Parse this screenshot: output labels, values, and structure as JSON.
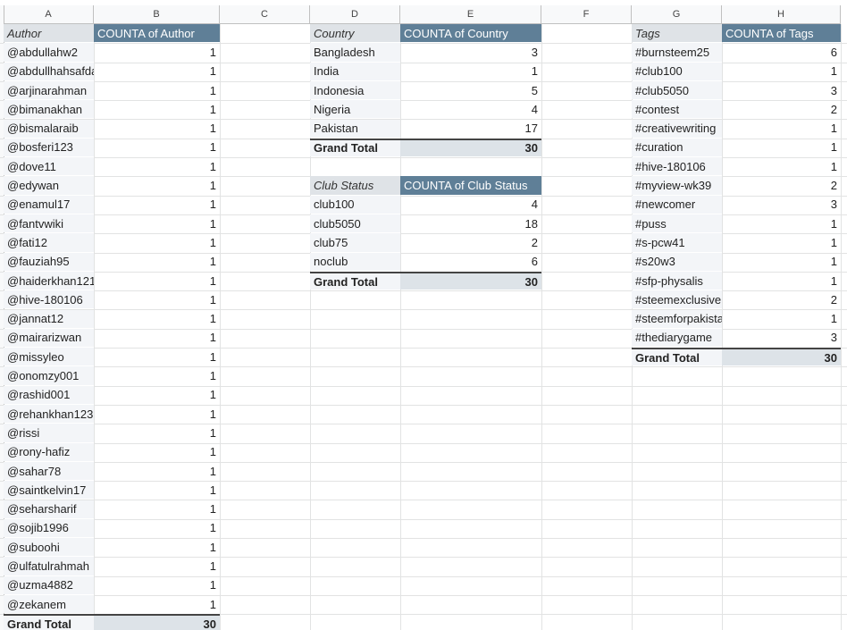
{
  "columns": [
    "A",
    "B",
    "C",
    "D",
    "E",
    "F",
    "G",
    "H"
  ],
  "author_pivot": {
    "header_label": "Author",
    "header_value": "COUNTA of Author",
    "rows": [
      {
        "label": "@abdullahw2",
        "value": "1"
      },
      {
        "label": "@abdullhahsafdar",
        "value": "1"
      },
      {
        "label": "@arjinarahman",
        "value": "1"
      },
      {
        "label": "@bimanakhan",
        "value": "1"
      },
      {
        "label": "@bismalaraib",
        "value": "1"
      },
      {
        "label": "@bosferi123",
        "value": "1"
      },
      {
        "label": "@dove11",
        "value": "1"
      },
      {
        "label": "@edywan",
        "value": "1"
      },
      {
        "label": "@enamul17",
        "value": "1"
      },
      {
        "label": "@fantvwiki",
        "value": "1"
      },
      {
        "label": "@fati12",
        "value": "1"
      },
      {
        "label": "@fauziah95",
        "value": "1"
      },
      {
        "label": "@haiderkhan121",
        "value": "1"
      },
      {
        "label": "@hive-180106",
        "value": "1"
      },
      {
        "label": "@jannat12",
        "value": "1"
      },
      {
        "label": "@mairarizwan",
        "value": "1"
      },
      {
        "label": "@missyleo",
        "value": "1"
      },
      {
        "label": "@onomzy001",
        "value": "1"
      },
      {
        "label": "@rashid001",
        "value": "1"
      },
      {
        "label": "@rehankhan123",
        "value": "1"
      },
      {
        "label": "@rissi",
        "value": "1"
      },
      {
        "label": "@rony-hafiz",
        "value": "1"
      },
      {
        "label": "@sahar78",
        "value": "1"
      },
      {
        "label": "@saintkelvin17",
        "value": "1"
      },
      {
        "label": "@seharsharif",
        "value": "1"
      },
      {
        "label": "@sojib1996",
        "value": "1"
      },
      {
        "label": "@suboohi",
        "value": "1"
      },
      {
        "label": "@ulfatulrahmah",
        "value": "1"
      },
      {
        "label": "@uzma4882",
        "value": "1"
      },
      {
        "label": "@zekanem",
        "value": "1"
      }
    ],
    "grand_total_label": "Grand Total",
    "grand_total_value": "30"
  },
  "country_pivot": {
    "header_label": "Country",
    "header_value": "COUNTA of Country",
    "rows": [
      {
        "label": "Bangladesh",
        "value": "3"
      },
      {
        "label": "India",
        "value": "1"
      },
      {
        "label": "Indonesia",
        "value": "5"
      },
      {
        "label": "Nigeria",
        "value": "4"
      },
      {
        "label": "Pakistan",
        "value": "17"
      }
    ],
    "grand_total_label": "Grand Total",
    "grand_total_value": "30"
  },
  "club_pivot": {
    "header_label": "Club Status",
    "header_value": "COUNTA of Club Status",
    "rows": [
      {
        "label": "club100",
        "value": "4"
      },
      {
        "label": "club5050",
        "value": "18"
      },
      {
        "label": "club75",
        "value": "2"
      },
      {
        "label": "noclub",
        "value": "6"
      }
    ],
    "grand_total_label": "Grand Total",
    "grand_total_value": "30"
  },
  "tags_pivot": {
    "header_label": "Tags",
    "header_value": "COUNTA of Tags",
    "rows": [
      {
        "label": "#burnsteem25",
        "value": "6"
      },
      {
        "label": "#club100",
        "value": "1"
      },
      {
        "label": "#club5050",
        "value": "3"
      },
      {
        "label": "#contest",
        "value": "2"
      },
      {
        "label": "#creativewriting",
        "value": "1"
      },
      {
        "label": "#curation",
        "value": "1"
      },
      {
        "label": "#hive-180106",
        "value": "1"
      },
      {
        "label": "#myview-wk39",
        "value": "2"
      },
      {
        "label": "#newcomer",
        "value": "3"
      },
      {
        "label": "#puss",
        "value": "1"
      },
      {
        "label": "#s-pcw41",
        "value": "1"
      },
      {
        "label": "#s20w3",
        "value": "1"
      },
      {
        "label": "#sfp-physalis",
        "value": "1"
      },
      {
        "label": "#steemexclusive",
        "value": "2"
      },
      {
        "label": "#steemforpakistan",
        "value": "1"
      },
      {
        "label": "#thediarygame",
        "value": "3"
      }
    ],
    "grand_total_label": "Grand Total",
    "grand_total_value": "30"
  }
}
